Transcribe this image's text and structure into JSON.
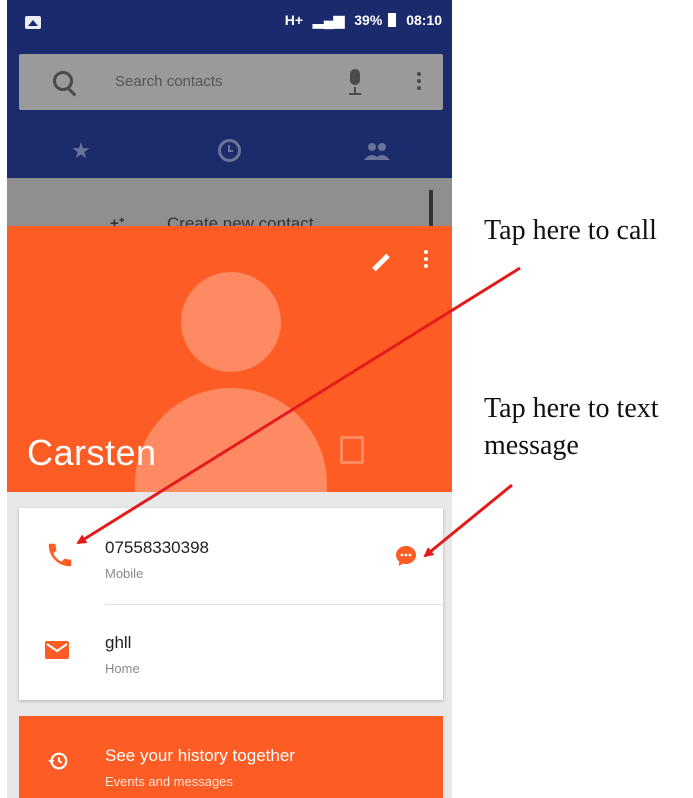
{
  "status_bar": {
    "network": "H+",
    "battery": "39%",
    "time": "08:10"
  },
  "search": {
    "placeholder": "Search contacts"
  },
  "tabs": [
    {
      "icon": "star-icon"
    },
    {
      "icon": "clock-icon"
    },
    {
      "icon": "people-icon"
    }
  ],
  "background_list": {
    "create_label": "Create new contact"
  },
  "contact": {
    "name": "Carsten"
  },
  "details": {
    "phone": {
      "number": "07558330398",
      "type": "Mobile"
    },
    "email": {
      "address": "ghll",
      "type": "Home"
    }
  },
  "history": {
    "title": "See your history together",
    "subtitle": "Events and messages"
  },
  "annotations": {
    "call": "Tap here to call",
    "text": "Tap here to text message"
  },
  "colors": {
    "accent": "#fd5d24",
    "appbar": "#1c2b6b",
    "arrow": "#e31b1b"
  }
}
